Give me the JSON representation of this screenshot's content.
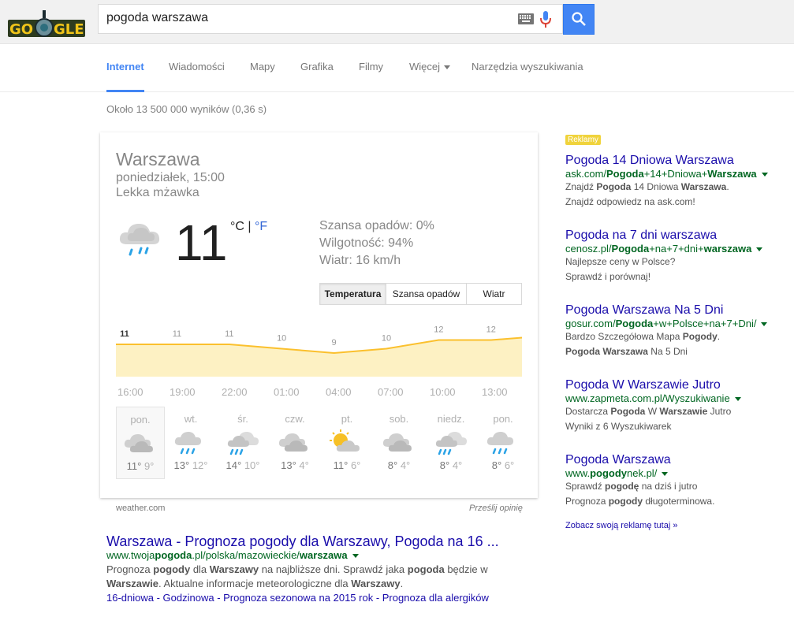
{
  "search": {
    "query": "pogoda warszawa",
    "logo_text": "GOOGLE"
  },
  "tabs": [
    "Internet",
    "Wiadomości",
    "Mapy",
    "Grafika",
    "Filmy",
    "Więcej",
    "Narzędzia wyszukiwania"
  ],
  "stats": "Około 13 500 000 wyników (0,36 s)",
  "weather": {
    "city": "Warszawa",
    "time": "poniedziałek, 15:00",
    "condition": "Lekka mżawka",
    "temp": "11",
    "unit_c": "°C",
    "unit_sep": "|",
    "unit_f": "°F",
    "precip": "Szansa opadów: 0%",
    "humidity": "Wilgotność: 94%",
    "wind": "Wiatr: 16 km/h",
    "buttons": [
      "Temperatura",
      "Szansa opadów",
      "Wiatr"
    ],
    "hours": [
      "16:00",
      "19:00",
      "22:00",
      "01:00",
      "04:00",
      "07:00",
      "10:00",
      "13:00"
    ],
    "hour_temps": [
      "11",
      "11",
      "11",
      "10",
      "9",
      "10",
      "12",
      "12"
    ],
    "days": [
      {
        "name": "pon.",
        "hi": "11°",
        "lo": "9°",
        "icon": "cloud-icon"
      },
      {
        "name": "wt.",
        "hi": "13°",
        "lo": "12°",
        "icon": "rain-icon"
      },
      {
        "name": "śr.",
        "hi": "14°",
        "lo": "10°",
        "icon": "rain-cloud-icon"
      },
      {
        "name": "czw.",
        "hi": "13°",
        "lo": "4°",
        "icon": "cloud-icon"
      },
      {
        "name": "pt.",
        "hi": "11°",
        "lo": "6°",
        "icon": "partly-sunny-icon"
      },
      {
        "name": "sob.",
        "hi": "8°",
        "lo": "4°",
        "icon": "cloud-icon"
      },
      {
        "name": "niedz.",
        "hi": "8°",
        "lo": "4°",
        "icon": "rain-cloud-icon"
      },
      {
        "name": "pon.",
        "hi": "8°",
        "lo": "6°",
        "icon": "rain-icon"
      }
    ],
    "source": "weather.com",
    "feedback": "Prześlij opinię"
  },
  "result": {
    "title": "Warszawa - Prognoza pogody dla Warszawy, Pogoda na 16 ...",
    "url_a": "www.twoja",
    "url_b": "pogoda",
    "url_c": ".pl/polska/mazowieckie/",
    "url_d": "warszawa",
    "s1a": "Prognoza ",
    "s1b": "pogody",
    "s1c": " dla ",
    "s1d": "Warszawy",
    "s1e": " na najbliższe dni. Sprawdź jaka ",
    "s1f": "pogoda",
    "s1g": " będzie w",
    "s2a": "Warszawie",
    "s2b": ". Aktualne informacje meteorologiczne dla ",
    "s2c": "Warszawy",
    "s2d": ".",
    "links": "16-dniowa - Godzinowa - Prognoza sezonowa na 2015 rok - Prognoza dla alergików"
  },
  "ads": {
    "badge": "Reklamy",
    "more": "Zobacz swoją reklamę tutaj »",
    "items": [
      {
        "title": "Pogoda 14 Dniowa Warszawa",
        "url_parts": [
          "ask.com/",
          "Pogoda",
          "+14+Dniowa+",
          "Warszawa"
        ],
        "line1": [
          "Znajdź ",
          "Pogoda",
          " 14 Dniowa ",
          "Warszawa",
          "."
        ],
        "line2": "Znajdź odpowiedz na ask.com!"
      },
      {
        "title": "Pogoda na 7 dni warszawa",
        "url_parts": [
          "cenosz.pl/",
          "Pogoda",
          "+na+7+dni+",
          "warszawa"
        ],
        "line1": [
          "Najlepsze ceny w Polsce?",
          "",
          "",
          "",
          ""
        ],
        "line2": "Sprawdź i porównaj!"
      },
      {
        "title": "Pogoda Warszawa Na 5 Dni",
        "url_parts": [
          "gosur.com/",
          "Pogoda",
          "+w+Polsce+na+7+Dni/",
          ""
        ],
        "line1": [
          "Bardzo Szczegółowa Mapa ",
          "Pogody",
          ".",
          "",
          ""
        ],
        "line2b": [
          "Pogoda",
          " ",
          "Warszawa",
          " Na 5 Dni"
        ]
      },
      {
        "title": "Pogoda W Warszawie Jutro",
        "url_parts": [
          "www.zapmeta.com.pl/Wyszukiwanie",
          "",
          "",
          ""
        ],
        "line1": [
          "Dostarcza ",
          "Pogoda",
          " W ",
          "Warszawie",
          " Jutro"
        ],
        "line2": "Wyniki z 6 Wyszukiwarek"
      },
      {
        "title": "Pogoda Warszawa",
        "url_parts": [
          "www.",
          "pogody",
          "nek.pl/",
          ""
        ],
        "line1": [
          "Sprawdź ",
          "pogodę",
          " na dziś i jutro",
          "",
          ""
        ],
        "line2c": [
          "Prognoza ",
          "pogody",
          " długoterminowa."
        ]
      }
    ]
  },
  "chart_data": {
    "type": "area",
    "categories": [
      "16:00",
      "19:00",
      "22:00",
      "01:00",
      "04:00",
      "07:00",
      "10:00",
      "13:00"
    ],
    "values": [
      11,
      11,
      11,
      10,
      9,
      10,
      12,
      12
    ],
    "fill_color": "#fdf1c3",
    "line_color": "#fbc02d"
  }
}
